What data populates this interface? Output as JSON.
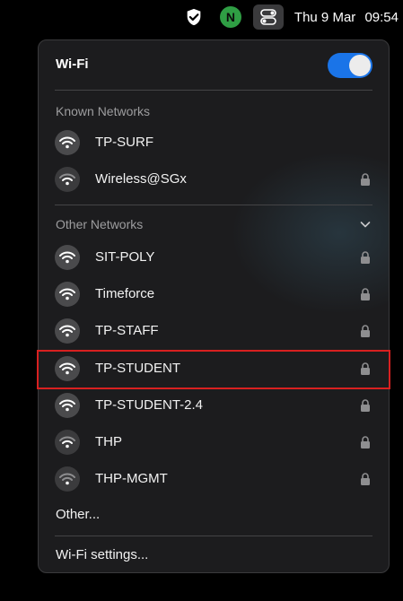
{
  "menubar": {
    "date": "Thu 9 Mar",
    "time": "09:54",
    "nord_letter": "N"
  },
  "wifi_panel": {
    "title": "Wi-Fi",
    "toggle_on": true,
    "known_header": "Known Networks",
    "known": [
      {
        "name": "TP-SURF",
        "locked": false,
        "signal": "strong"
      },
      {
        "name": "Wireless@SGx",
        "locked": true,
        "signal": "weak"
      }
    ],
    "other_header": "Other Networks",
    "other": [
      {
        "name": "SIT-POLY",
        "locked": true,
        "signal": "strong"
      },
      {
        "name": "Timeforce",
        "locked": true,
        "signal": "strong"
      },
      {
        "name": "TP-STAFF",
        "locked": true,
        "signal": "strong"
      },
      {
        "name": "TP-STUDENT",
        "locked": true,
        "signal": "strong"
      },
      {
        "name": "TP-STUDENT-2.4",
        "locked": true,
        "signal": "strong"
      },
      {
        "name": "THP",
        "locked": true,
        "signal": "weak"
      },
      {
        "name": "THP-MGMT",
        "locked": true,
        "signal": "weak"
      }
    ],
    "other_link": "Other...",
    "settings_link": "Wi-Fi settings..."
  },
  "colors": {
    "toggle_accent": "#1a74e8",
    "highlight_border": "#d82020"
  }
}
